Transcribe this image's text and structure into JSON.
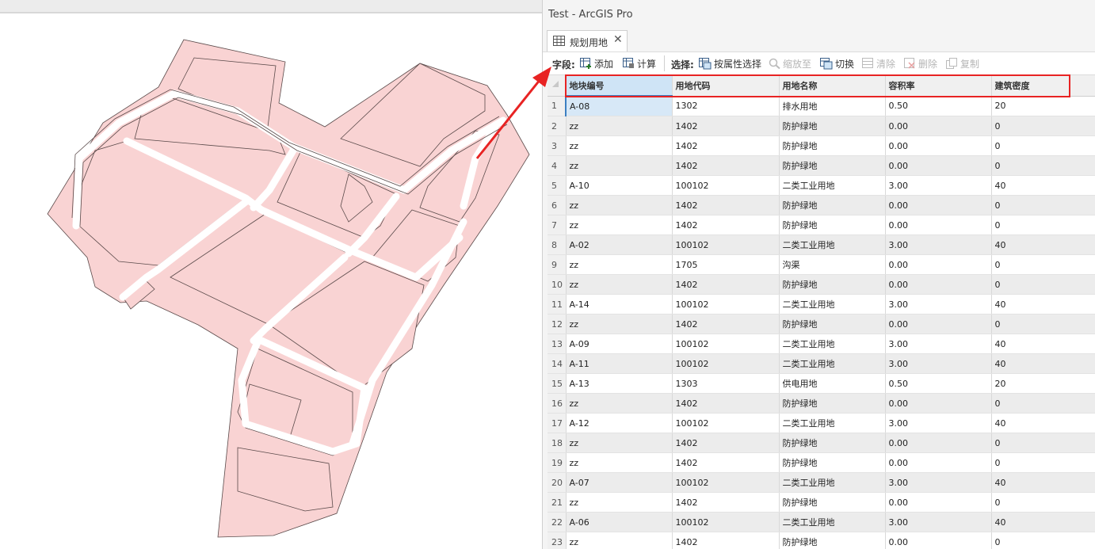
{
  "window": {
    "title": "Test - ArcGIS Pro"
  },
  "tab": {
    "label": "规划用地",
    "close": "✕"
  },
  "toolbar": {
    "fields_label": "字段:",
    "add": "添加",
    "calculate": "计算",
    "selection_label": "选择:",
    "select_by_attr": "按属性选择",
    "zoom_to": "缩放至",
    "switch": "切换",
    "clear": "清除",
    "delete": "删除",
    "copy": "复制"
  },
  "table": {
    "columns": [
      "地块编号",
      "用地代码",
      "用地名称",
      "容积率",
      "建筑密度"
    ],
    "rows": [
      {
        "n": "1",
        "c": [
          "A-08",
          "1302",
          "排水用地",
          "0.50",
          "20"
        ]
      },
      {
        "n": "2",
        "c": [
          "zz",
          "1402",
          "防护绿地",
          "0.00",
          "0"
        ]
      },
      {
        "n": "3",
        "c": [
          "zz",
          "1402",
          "防护绿地",
          "0.00",
          "0"
        ]
      },
      {
        "n": "4",
        "c": [
          "zz",
          "1402",
          "防护绿地",
          "0.00",
          "0"
        ]
      },
      {
        "n": "5",
        "c": [
          "A-10",
          "100102",
          "二类工业用地",
          "3.00",
          "40"
        ]
      },
      {
        "n": "6",
        "c": [
          "zz",
          "1402",
          "防护绿地",
          "0.00",
          "0"
        ]
      },
      {
        "n": "7",
        "c": [
          "zz",
          "1402",
          "防护绿地",
          "0.00",
          "0"
        ]
      },
      {
        "n": "8",
        "c": [
          "A-02",
          "100102",
          "二类工业用地",
          "3.00",
          "40"
        ]
      },
      {
        "n": "9",
        "c": [
          "zz",
          "1705",
          "沟渠",
          "0.00",
          "0"
        ]
      },
      {
        "n": "10",
        "c": [
          "zz",
          "1402",
          "防护绿地",
          "0.00",
          "0"
        ]
      },
      {
        "n": "11",
        "c": [
          "A-14",
          "100102",
          "二类工业用地",
          "3.00",
          "40"
        ]
      },
      {
        "n": "12",
        "c": [
          "zz",
          "1402",
          "防护绿地",
          "0.00",
          "0"
        ]
      },
      {
        "n": "13",
        "c": [
          "A-09",
          "100102",
          "二类工业用地",
          "3.00",
          "40"
        ]
      },
      {
        "n": "14",
        "c": [
          "A-11",
          "100102",
          "二类工业用地",
          "3.00",
          "40"
        ]
      },
      {
        "n": "15",
        "c": [
          "A-13",
          "1303",
          "供电用地",
          "0.50",
          "20"
        ]
      },
      {
        "n": "16",
        "c": [
          "zz",
          "1402",
          "防护绿地",
          "0.00",
          "0"
        ]
      },
      {
        "n": "17",
        "c": [
          "A-12",
          "100102",
          "二类工业用地",
          "3.00",
          "40"
        ]
      },
      {
        "n": "18",
        "c": [
          "zz",
          "1402",
          "防护绿地",
          "0.00",
          "0"
        ]
      },
      {
        "n": "19",
        "c": [
          "zz",
          "1402",
          "防护绿地",
          "0.00",
          "0"
        ]
      },
      {
        "n": "20",
        "c": [
          "A-07",
          "100102",
          "二类工业用地",
          "3.00",
          "40"
        ]
      },
      {
        "n": "21",
        "c": [
          "zz",
          "1402",
          "防护绿地",
          "0.00",
          "0"
        ]
      },
      {
        "n": "22",
        "c": [
          "A-06",
          "100102",
          "二类工业用地",
          "3.00",
          "40"
        ]
      },
      {
        "n": "23",
        "c": [
          "zz",
          "1402",
          "防护绿地",
          "0.00",
          "0"
        ]
      }
    ]
  },
  "colors": {
    "parcel_fill": "#f9d3d3",
    "parcel_stroke": "#5a4a4a",
    "annotation": "#e82323",
    "selection": "#3c7fc1"
  }
}
